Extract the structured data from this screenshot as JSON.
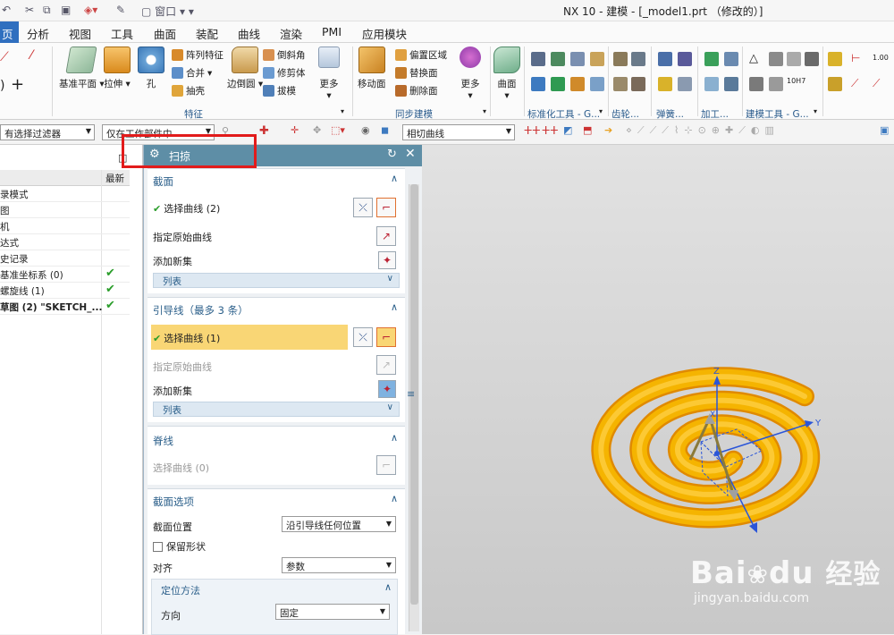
{
  "window": {
    "title": "NX 10 - 建模 - [_model1.prt （修改的）]",
    "window_menu": "窗口"
  },
  "tabs": [
    {
      "label": "页",
      "active": true
    },
    {
      "label": "分析"
    },
    {
      "label": "视图"
    },
    {
      "label": "工具"
    },
    {
      "label": "曲面"
    },
    {
      "label": "装配"
    },
    {
      "label": "曲线"
    },
    {
      "label": "渲染"
    },
    {
      "label": "PMI"
    },
    {
      "label": "应用模块"
    }
  ],
  "ribbon": {
    "datum_plane": "基准平面",
    "extrude": "拉伸",
    "hole": "孔",
    "pattern_feature": "阵列特征",
    "unite": "合并",
    "shell": "抽壳",
    "edge_blend": "边倒圆",
    "chamfer": "倒斜角",
    "trim_body": "修剪体",
    "draft": "拔模",
    "more": "更多",
    "move_face": "移动面",
    "offset_region": "偏置区域",
    "replace_face": "替换面",
    "delete_face": "删除面",
    "surface": "曲面",
    "group_feature": "特征",
    "group_sync": "同步建模",
    "group_standard": "标准化工具 - G...",
    "group_gear": "齿轮...",
    "group_spring": "弹簧...",
    "group_machining": "加工...",
    "group_build": "建模工具 - G...",
    "label_100": "1.00",
    "label_10h7": "10H7"
  },
  "filterbar": {
    "selection_filter": "有选择过滤器",
    "scope": "仅在工作部件中",
    "curve_rule": "相切曲线"
  },
  "navigator": {
    "col_latest": "最新",
    "rows": [
      {
        "label": "录模式",
        "check": ""
      },
      {
        "label": "图",
        "check": ""
      },
      {
        "label": "机",
        "check": ""
      },
      {
        "label": "达式",
        "check": ""
      },
      {
        "label": "史记录",
        "check": ""
      },
      {
        "label": "基准坐标系 (0)",
        "check": "✔"
      },
      {
        "label": "螺旋线 (1)",
        "check": "✔"
      },
      {
        "label": "草图 (2) \"SKETCH_...",
        "check": "✔",
        "bold": true
      }
    ]
  },
  "dialog": {
    "title": "扫掠",
    "section": {
      "header": "截面",
      "select_curve": "选择曲线 (2)",
      "specify_origin": "指定原始曲线",
      "add_new_set": "添加新集",
      "list": "列表"
    },
    "guides": {
      "header": "引导线（最多 3 条）",
      "select_curve": "选择曲线 (1)",
      "specify_origin": "指定原始曲线",
      "add_new_set": "添加新集",
      "list": "列表"
    },
    "spine": {
      "header": "脊线",
      "select_curve": "选择曲线 (0)"
    },
    "section_options": {
      "header": "截面选项",
      "position_label": "截面位置",
      "position_value": "沿引导线任何位置",
      "preserve_shape": "保留形状",
      "alignment_label": "对齐",
      "alignment_value": "参数",
      "orientation_header": "定位方法",
      "direction_label": "方向",
      "direction_value": "固定"
    }
  },
  "viewport": {
    "axis_x": "X",
    "axis_y": "Y",
    "axis_z": "Z",
    "colors": {
      "tube": "#f5b400",
      "tube_dark": "#e08a00",
      "background": "#d4d4d4"
    }
  },
  "watermark": {
    "brand": "Bai",
    "brand2": "du",
    "jingyan": "经验",
    "url": "jingyan.baidu.com"
  }
}
